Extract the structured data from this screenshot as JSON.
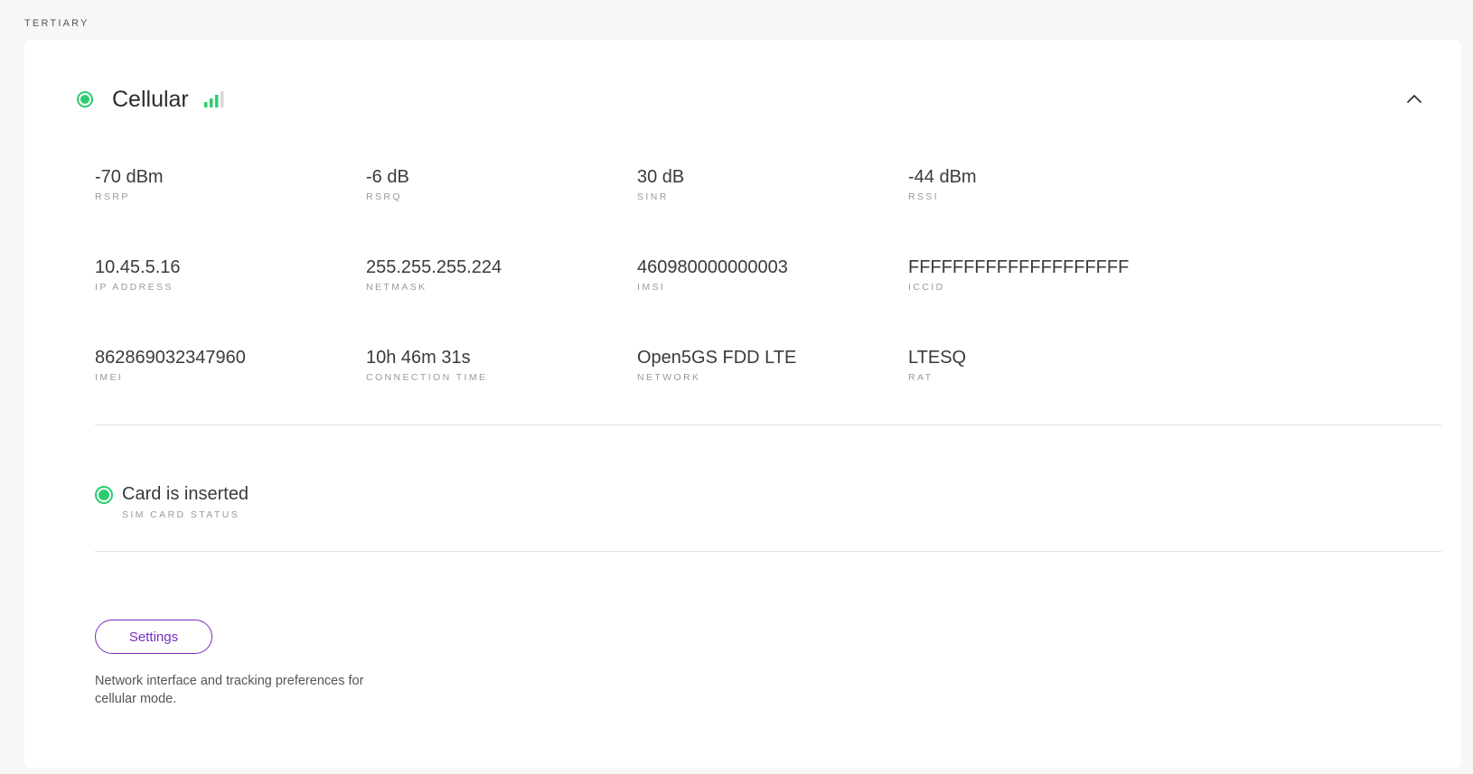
{
  "section_label": "TERTIARY",
  "card": {
    "title": "Cellular",
    "status": "connected",
    "signal_bars": {
      "filled": 3,
      "total": 4
    },
    "colors": {
      "status_green": "#2ecc71",
      "accent_purple": "#7b2cbf"
    },
    "metrics": [
      [
        {
          "value": "-70 dBm",
          "label": "RSRP"
        },
        {
          "value": "-6 dB",
          "label": "RSRQ"
        },
        {
          "value": "30 dB",
          "label": "SINR"
        },
        {
          "value": "-44 dBm",
          "label": "RSSI"
        }
      ],
      [
        {
          "value": "10.45.5.16",
          "label": "IP ADDRESS"
        },
        {
          "value": "255.255.255.224",
          "label": "NETMASK"
        },
        {
          "value": "460980000000003",
          "label": "IMSI"
        },
        {
          "value": "FFFFFFFFFFFFFFFFFFFF",
          "label": "ICCID"
        }
      ],
      [
        {
          "value": "862869032347960",
          "label": "IMEI"
        },
        {
          "value": "10h 46m 31s",
          "label": "CONNECTION TIME"
        },
        {
          "value": "Open5GS FDD LTE",
          "label": "NETWORK"
        },
        {
          "value": "LTESQ",
          "label": "RAT"
        }
      ]
    ],
    "sim": {
      "value": "Card is inserted",
      "label": "SIM CARD STATUS"
    },
    "settings_label": "Settings",
    "description": "Network interface and tracking preferences for cellular mode."
  }
}
